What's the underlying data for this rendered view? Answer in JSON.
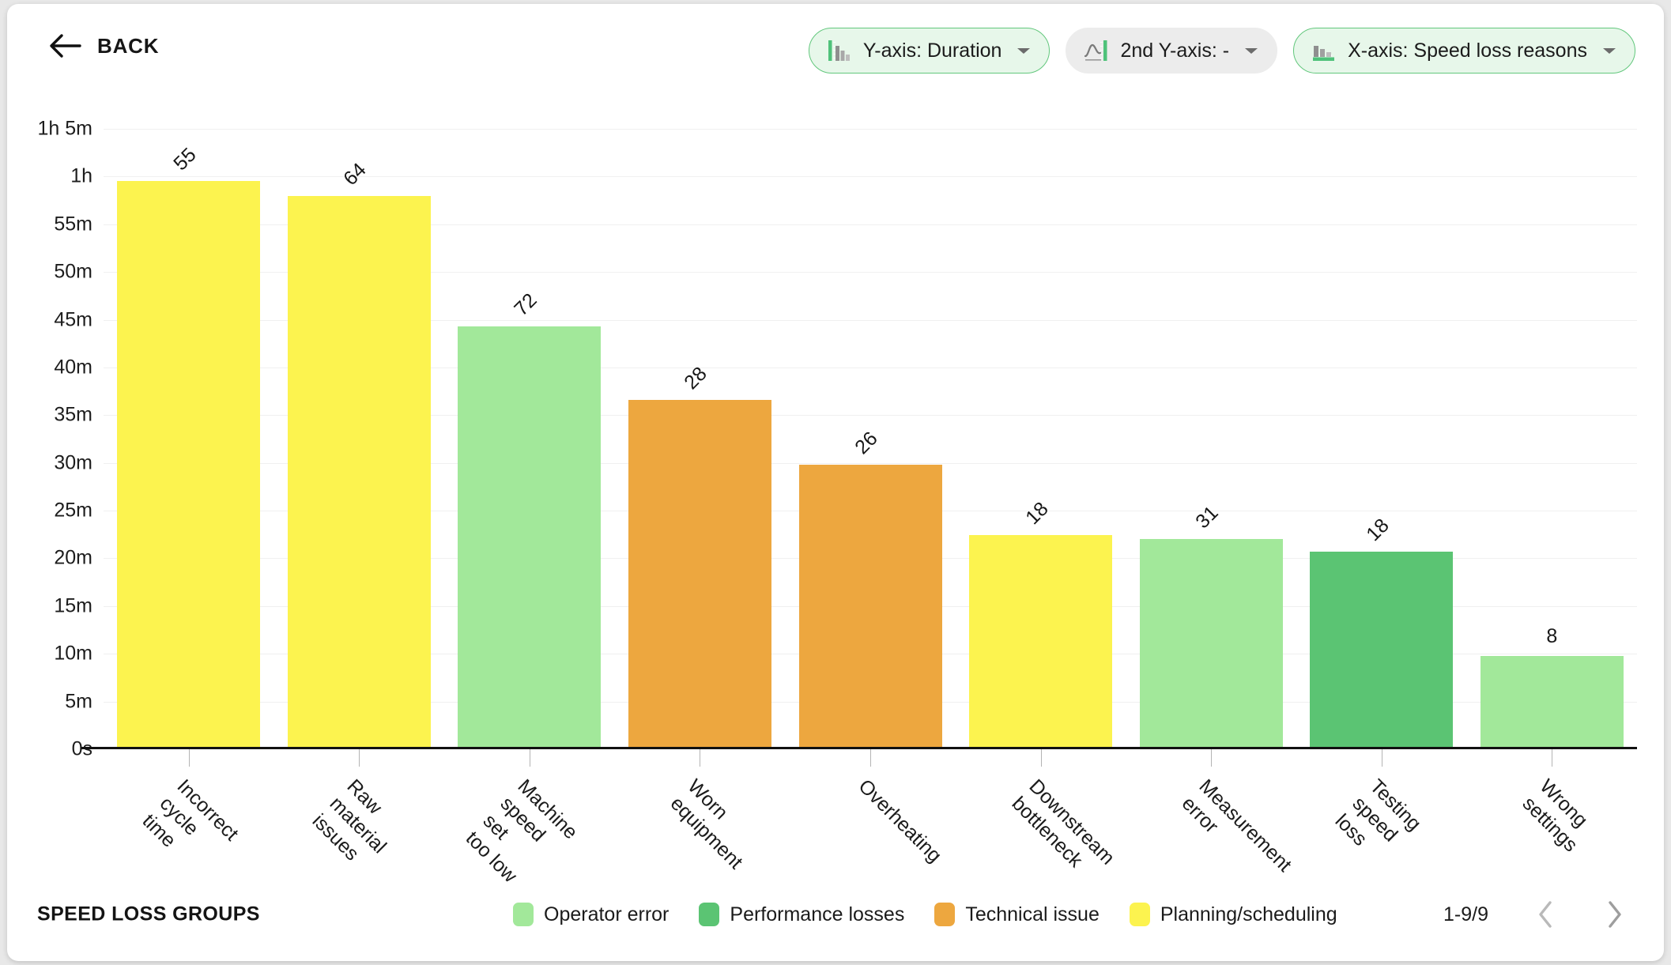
{
  "header": {
    "back_label": "BACK",
    "back_icon": "arrow-left-icon",
    "controls": [
      {
        "label": "Y-axis: Duration",
        "icon": "bar-chart-y-axis-icon",
        "state": "active"
      },
      {
        "label": "2nd Y-axis: -",
        "icon": "line-chart-y-axis-icon",
        "state": "inactive"
      },
      {
        "label": "X-axis: Speed loss reasons",
        "icon": "bar-chart-x-axis-icon",
        "state": "active"
      }
    ]
  },
  "footer": {
    "title": "SPEED LOSS GROUPS",
    "legend": [
      {
        "label": "Operator error",
        "color": "#a2e89a"
      },
      {
        "label": "Performance losses",
        "color": "#5bc473"
      },
      {
        "label": "Technical issue",
        "color": "#eda73f"
      },
      {
        "label": "Planning/scheduling",
        "color": "#fcf34f"
      }
    ],
    "pagination": {
      "range": "1-9/9",
      "prev_icon": "chevron-left-icon",
      "next_icon": "chevron-right-icon"
    }
  },
  "chart_data": {
    "type": "bar",
    "title": "",
    "xlabel": "Speed loss reasons",
    "ylabel": "Duration",
    "ylim": [
      0,
      65
    ],
    "grid": true,
    "legend_position": "bottom",
    "y_unit": "minutes",
    "y_ticks": [
      {
        "value": 65,
        "label": "1h 5m"
      },
      {
        "value": 60,
        "label": "1h"
      },
      {
        "value": 55,
        "label": "55m"
      },
      {
        "value": 50,
        "label": "50m"
      },
      {
        "value": 45,
        "label": "45m"
      },
      {
        "value": 40,
        "label": "40m"
      },
      {
        "value": 35,
        "label": "35m"
      },
      {
        "value": 30,
        "label": "30m"
      },
      {
        "value": 25,
        "label": "25m"
      },
      {
        "value": 20,
        "label": "20m"
      },
      {
        "value": 15,
        "label": "15m"
      },
      {
        "value": 10,
        "label": "10m"
      },
      {
        "value": 5,
        "label": "5m"
      },
      {
        "value": 0,
        "label": "0s"
      }
    ],
    "categories": [
      "Incorrect cycle time",
      "Raw material issues",
      "Machine speed set too low",
      "Worn equipment",
      "Overheating",
      "Downstream bottleneck",
      "Measurement error",
      "Testing speed loss",
      "Wrong settings"
    ],
    "category_lines": [
      "Incorrect cycle time",
      "Raw material\nissues",
      "Machine speed set\ntoo low",
      "Worn equipment",
      "Overheating",
      "Downstream\nbottleneck",
      "Measurement\nerror",
      "Testing speed loss",
      "Wrong settings"
    ],
    "values": [
      59.5,
      58.0,
      44.3,
      36.6,
      29.8,
      22.4,
      22.0,
      20.7,
      9.8
    ],
    "point_labels": [
      "55",
      "64",
      "72",
      "28",
      "26",
      "18",
      "31",
      "18",
      "8"
    ],
    "point_label_rotated": [
      true,
      true,
      true,
      true,
      true,
      true,
      true,
      true,
      false
    ],
    "colors": [
      "#fcf34f",
      "#fcf34f",
      "#a2e89a",
      "#eda73f",
      "#eda73f",
      "#fcf34f",
      "#a2e89a",
      "#5bc473",
      "#a2e89a"
    ],
    "series": [
      {
        "name": "Duration",
        "values": [
          59.5,
          58.0,
          44.3,
          36.6,
          29.8,
          22.4,
          22.0,
          20.7,
          9.8
        ]
      }
    ],
    "group_of_category": [
      "Planning/scheduling",
      "Planning/scheduling",
      "Operator error",
      "Technical issue",
      "Technical issue",
      "Planning/scheduling",
      "Operator error",
      "Performance losses",
      "Operator error"
    ]
  }
}
